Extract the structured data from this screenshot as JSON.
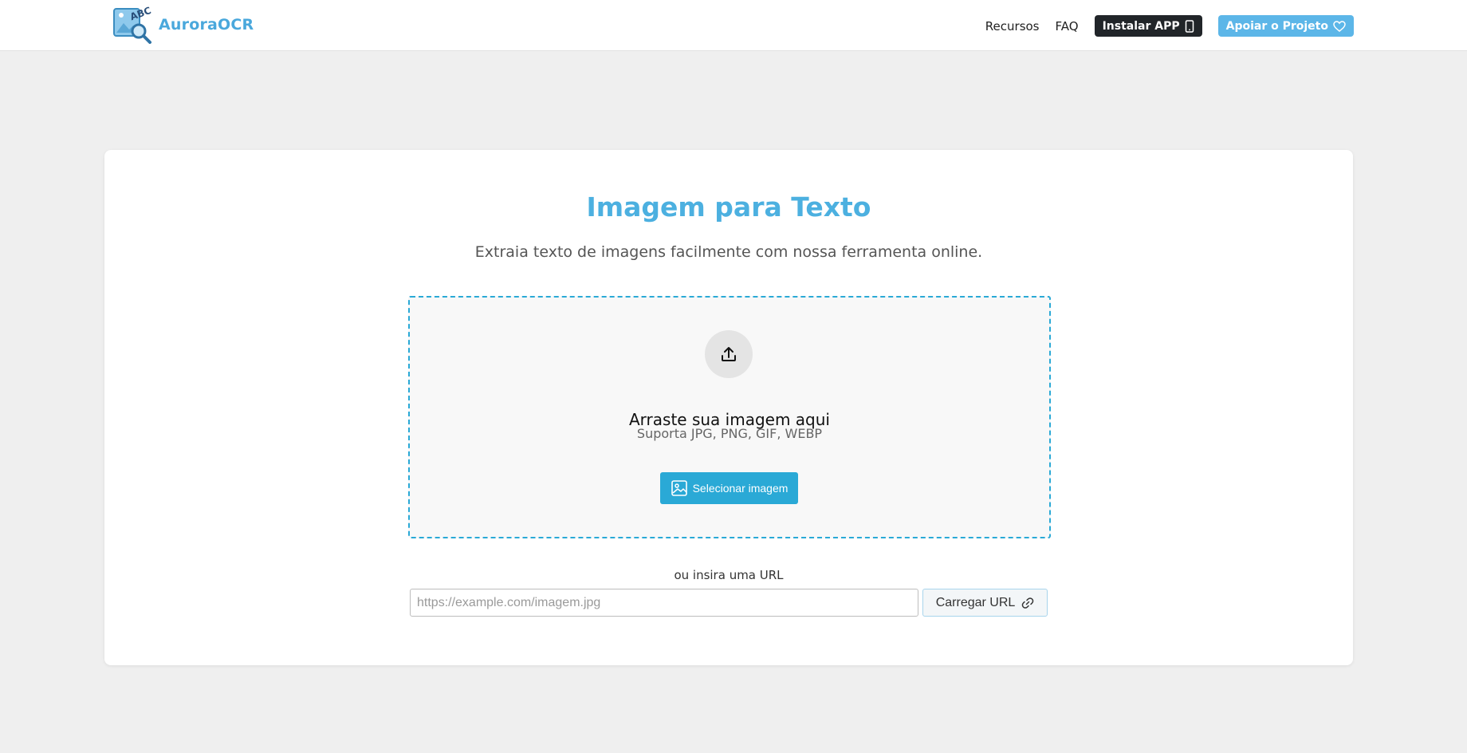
{
  "header": {
    "brand": "AuroraOCR",
    "logo_letters": "ABC",
    "nav": {
      "features": "Recursos",
      "faq": "FAQ",
      "install": "Instalar APP",
      "support": "Apoiar o Projeto"
    }
  },
  "main": {
    "title": "Imagem para Texto",
    "subtitle": "Extraia texto de imagens facilmente com nossa ferramenta online.",
    "dropzone": {
      "title": "Arraste sua imagem aqui",
      "formats": "Suporta JPG, PNG, GIF, WEBP",
      "select_button": "Selecionar imagem"
    },
    "url": {
      "label": "ou insira uma URL",
      "placeholder": "https://example.com/imagem.jpg",
      "value": "",
      "load_button": "Carregar URL"
    }
  },
  "icons": {
    "logo": "image-search-logo-icon",
    "install": "phone-icon",
    "support": "heart-icon",
    "upload": "upload-icon",
    "select": "image-icon",
    "load": "link-icon"
  },
  "colors": {
    "brand": "#4aa8dc",
    "title": "#4cb0e0",
    "accent": "#2aa9d6",
    "dark_button": "#212529",
    "support_button": "#5cb6e8",
    "page_background": "#efefef"
  }
}
